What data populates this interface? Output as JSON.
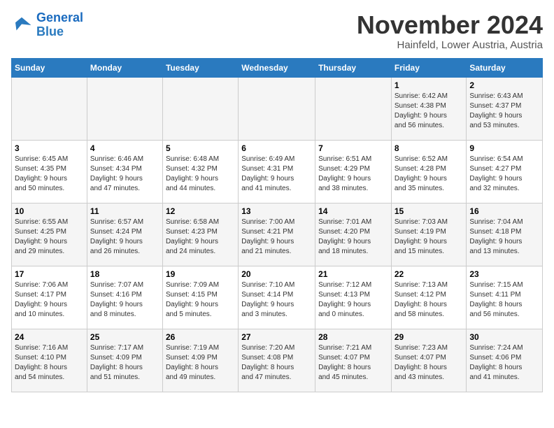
{
  "logo": {
    "line1": "General",
    "line2": "Blue"
  },
  "title": "November 2024",
  "location": "Hainfeld, Lower Austria, Austria",
  "weekdays": [
    "Sunday",
    "Monday",
    "Tuesday",
    "Wednesday",
    "Thursday",
    "Friday",
    "Saturday"
  ],
  "weeks": [
    [
      {
        "day": "",
        "info": ""
      },
      {
        "day": "",
        "info": ""
      },
      {
        "day": "",
        "info": ""
      },
      {
        "day": "",
        "info": ""
      },
      {
        "day": "",
        "info": ""
      },
      {
        "day": "1",
        "info": "Sunrise: 6:42 AM\nSunset: 4:38 PM\nDaylight: 9 hours\nand 56 minutes."
      },
      {
        "day": "2",
        "info": "Sunrise: 6:43 AM\nSunset: 4:37 PM\nDaylight: 9 hours\nand 53 minutes."
      }
    ],
    [
      {
        "day": "3",
        "info": "Sunrise: 6:45 AM\nSunset: 4:35 PM\nDaylight: 9 hours\nand 50 minutes."
      },
      {
        "day": "4",
        "info": "Sunrise: 6:46 AM\nSunset: 4:34 PM\nDaylight: 9 hours\nand 47 minutes."
      },
      {
        "day": "5",
        "info": "Sunrise: 6:48 AM\nSunset: 4:32 PM\nDaylight: 9 hours\nand 44 minutes."
      },
      {
        "day": "6",
        "info": "Sunrise: 6:49 AM\nSunset: 4:31 PM\nDaylight: 9 hours\nand 41 minutes."
      },
      {
        "day": "7",
        "info": "Sunrise: 6:51 AM\nSunset: 4:29 PM\nDaylight: 9 hours\nand 38 minutes."
      },
      {
        "day": "8",
        "info": "Sunrise: 6:52 AM\nSunset: 4:28 PM\nDaylight: 9 hours\nand 35 minutes."
      },
      {
        "day": "9",
        "info": "Sunrise: 6:54 AM\nSunset: 4:27 PM\nDaylight: 9 hours\nand 32 minutes."
      }
    ],
    [
      {
        "day": "10",
        "info": "Sunrise: 6:55 AM\nSunset: 4:25 PM\nDaylight: 9 hours\nand 29 minutes."
      },
      {
        "day": "11",
        "info": "Sunrise: 6:57 AM\nSunset: 4:24 PM\nDaylight: 9 hours\nand 26 minutes."
      },
      {
        "day": "12",
        "info": "Sunrise: 6:58 AM\nSunset: 4:23 PM\nDaylight: 9 hours\nand 24 minutes."
      },
      {
        "day": "13",
        "info": "Sunrise: 7:00 AM\nSunset: 4:21 PM\nDaylight: 9 hours\nand 21 minutes."
      },
      {
        "day": "14",
        "info": "Sunrise: 7:01 AM\nSunset: 4:20 PM\nDaylight: 9 hours\nand 18 minutes."
      },
      {
        "day": "15",
        "info": "Sunrise: 7:03 AM\nSunset: 4:19 PM\nDaylight: 9 hours\nand 15 minutes."
      },
      {
        "day": "16",
        "info": "Sunrise: 7:04 AM\nSunset: 4:18 PM\nDaylight: 9 hours\nand 13 minutes."
      }
    ],
    [
      {
        "day": "17",
        "info": "Sunrise: 7:06 AM\nSunset: 4:17 PM\nDaylight: 9 hours\nand 10 minutes."
      },
      {
        "day": "18",
        "info": "Sunrise: 7:07 AM\nSunset: 4:16 PM\nDaylight: 9 hours\nand 8 minutes."
      },
      {
        "day": "19",
        "info": "Sunrise: 7:09 AM\nSunset: 4:15 PM\nDaylight: 9 hours\nand 5 minutes."
      },
      {
        "day": "20",
        "info": "Sunrise: 7:10 AM\nSunset: 4:14 PM\nDaylight: 9 hours\nand 3 minutes."
      },
      {
        "day": "21",
        "info": "Sunrise: 7:12 AM\nSunset: 4:13 PM\nDaylight: 9 hours\nand 0 minutes."
      },
      {
        "day": "22",
        "info": "Sunrise: 7:13 AM\nSunset: 4:12 PM\nDaylight: 8 hours\nand 58 minutes."
      },
      {
        "day": "23",
        "info": "Sunrise: 7:15 AM\nSunset: 4:11 PM\nDaylight: 8 hours\nand 56 minutes."
      }
    ],
    [
      {
        "day": "24",
        "info": "Sunrise: 7:16 AM\nSunset: 4:10 PM\nDaylight: 8 hours\nand 54 minutes."
      },
      {
        "day": "25",
        "info": "Sunrise: 7:17 AM\nSunset: 4:09 PM\nDaylight: 8 hours\nand 51 minutes."
      },
      {
        "day": "26",
        "info": "Sunrise: 7:19 AM\nSunset: 4:09 PM\nDaylight: 8 hours\nand 49 minutes."
      },
      {
        "day": "27",
        "info": "Sunrise: 7:20 AM\nSunset: 4:08 PM\nDaylight: 8 hours\nand 47 minutes."
      },
      {
        "day": "28",
        "info": "Sunrise: 7:21 AM\nSunset: 4:07 PM\nDaylight: 8 hours\nand 45 minutes."
      },
      {
        "day": "29",
        "info": "Sunrise: 7:23 AM\nSunset: 4:07 PM\nDaylight: 8 hours\nand 43 minutes."
      },
      {
        "day": "30",
        "info": "Sunrise: 7:24 AM\nSunset: 4:06 PM\nDaylight: 8 hours\nand 41 minutes."
      }
    ]
  ]
}
